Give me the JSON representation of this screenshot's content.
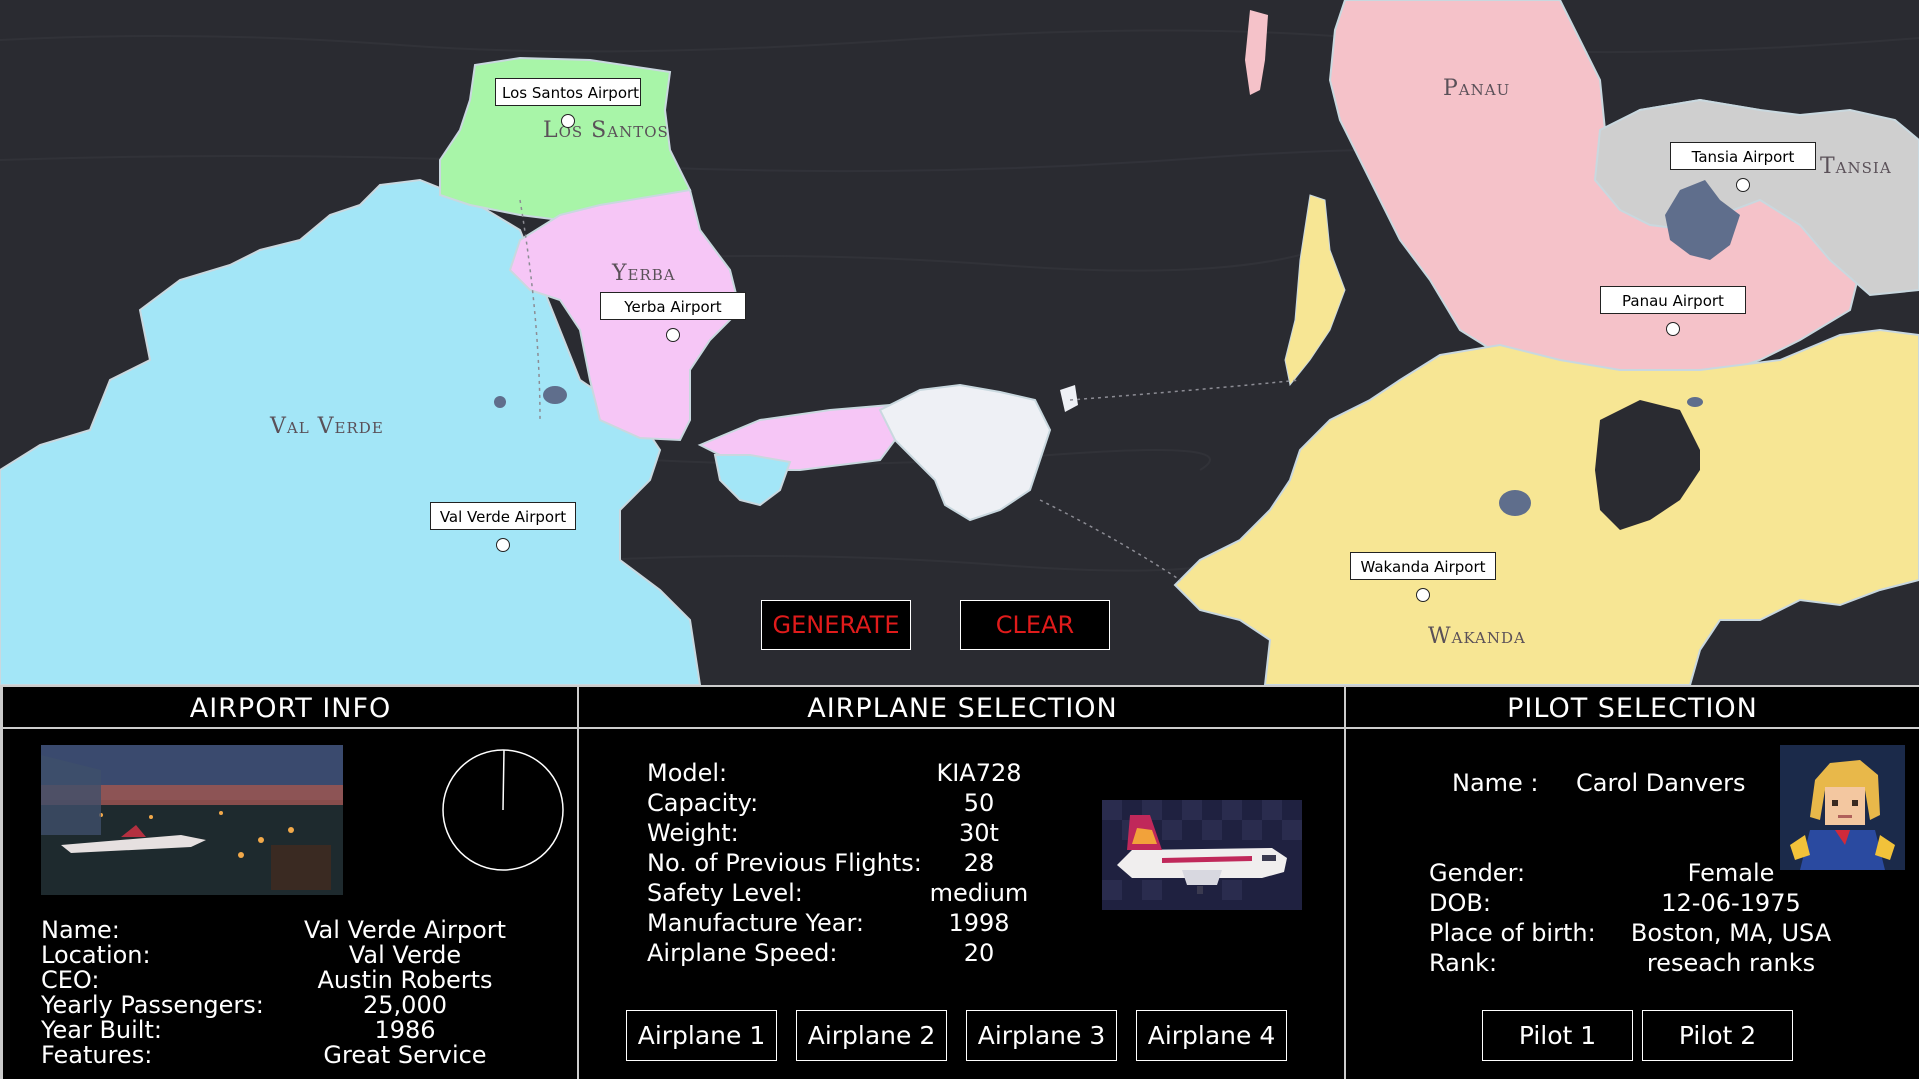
{
  "map": {
    "regions": [
      {
        "id": "los-santos",
        "name": "Los Santos"
      },
      {
        "id": "yerba",
        "name": "Yerba"
      },
      {
        "id": "val-verde",
        "name": "Val Verde"
      },
      {
        "id": "panau",
        "name": "Panau"
      },
      {
        "id": "tansia",
        "name": "Tansia"
      },
      {
        "id": "wakanda",
        "name": "Wakanda"
      }
    ],
    "airports": [
      {
        "id": "los-santos",
        "label": "Los Santos Airport"
      },
      {
        "id": "yerba",
        "label": "Yerba Airport"
      },
      {
        "id": "val-verde",
        "label": "Val Verde Airport"
      },
      {
        "id": "tansia",
        "label": "Tansia Airport"
      },
      {
        "id": "panau",
        "label": "Panau Airport"
      },
      {
        "id": "wakanda",
        "label": "Wakanda Airport"
      }
    ],
    "generate_label": "GENERATE",
    "clear_label": "CLEAR",
    "button_color": "#e01b1b"
  },
  "airport_info": {
    "title": "AIRPORT INFO",
    "fields": [
      {
        "label": "Name:",
        "value": "Val Verde Airport"
      },
      {
        "label": "Location:",
        "value": "Val Verde"
      },
      {
        "label": "CEO:",
        "value": "Austin Roberts"
      },
      {
        "label": "Yearly Passengers:",
        "value": "25,000"
      },
      {
        "label": "Year Built:",
        "value": "1986"
      },
      {
        "label": "Features:",
        "value": "Great Service"
      }
    ]
  },
  "airplane_selection": {
    "title": "AIRPLANE SELECTION",
    "fields": [
      {
        "label": "Model:",
        "value": "KIA728"
      },
      {
        "label": "Capacity:",
        "value": "50"
      },
      {
        "label": "Weight:",
        "value": "30t"
      },
      {
        "label": "No. of Previous Flights:",
        "value": "28"
      },
      {
        "label": "Safety Level:",
        "value": "medium"
      },
      {
        "label": "Manufacture Year:",
        "value": "1998"
      },
      {
        "label": "Airplane Speed:",
        "value": "20"
      }
    ],
    "buttons": [
      "Airplane 1",
      "Airplane 2",
      "Airplane 3",
      "Airplane 4"
    ]
  },
  "pilot_selection": {
    "title": "PILOT SELECTION",
    "name_label": "Name :",
    "name_value": "Carol Danvers",
    "fields": [
      {
        "label": "Gender:",
        "value": "Female"
      },
      {
        "label": "DOB:",
        "value": "12-06-1975"
      },
      {
        "label": "Place of birth:",
        "value": "Boston, MA, USA"
      },
      {
        "label": "Rank:",
        "value": "reseach ranks"
      }
    ],
    "buttons": [
      "Pilot 1",
      "Pilot 2"
    ]
  },
  "colors": {
    "ocean": "#2a2b31",
    "los_santos": "#a8f5a8",
    "yerba": "#f6c6f6",
    "val_verde": "#a3e6f7",
    "panau": "#f5c2c9",
    "tansia": "#cfcfcf",
    "wakanda": "#f7e694",
    "island": "#eef0f5"
  }
}
